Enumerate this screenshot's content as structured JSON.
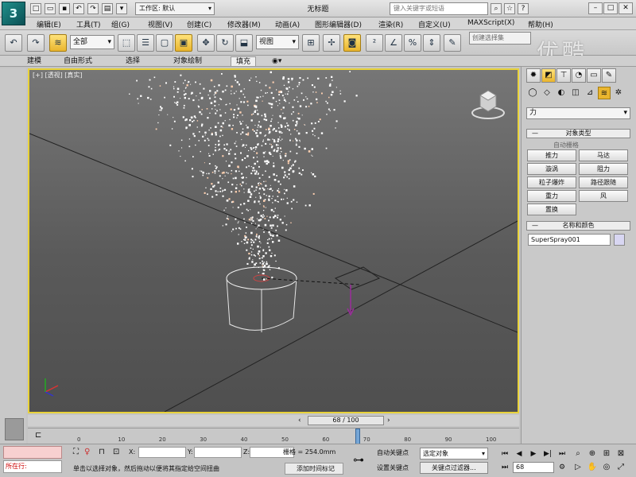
{
  "title_bar": {
    "app_logo": "3",
    "workspace": "工作区: 默认",
    "doc_title": "无标题",
    "help_search_placeholder": "键入关键字或短语"
  },
  "menu": [
    "编辑(E)",
    "工具(T)",
    "组(G)",
    "视图(V)",
    "创建(C)",
    "修改器(M)",
    "动画(A)",
    "图形编辑器(D)",
    "渲染(R)",
    "自定义(U)",
    "MAXScript(X)",
    "帮助(H)"
  ],
  "toolbar": {
    "selection_filter": "全部",
    "ref_coord": "视图",
    "named_sel_placeholder": "创建选择集",
    "icons": [
      "undo-icon",
      "redo-icon",
      "link-icon",
      "unlink-icon",
      "bind-space-warp-icon",
      "select-object-icon",
      "select-by-name-icon",
      "rect-region-icon",
      "window-crossing-icon",
      "move-icon",
      "rotate-icon",
      "scale-icon",
      "pivot-icon",
      "snap-icon",
      "angle-snap-icon",
      "percent-snap-icon",
      "spinner-snap-icon",
      "mirror-icon",
      "align-icon"
    ]
  },
  "watermark": "优酷",
  "ribbon": {
    "tabs": [
      "建模",
      "自由形式",
      "选择",
      "对象绘制",
      "填充"
    ],
    "active": "填充"
  },
  "viewport": {
    "label": "[+] [透视] [真实]"
  },
  "command_panel": {
    "tabs": [
      "create-icon",
      "modify-icon",
      "hierarchy-icon",
      "motion-icon",
      "display-icon",
      "utilities-icon"
    ],
    "sub_tabs": [
      "geometry-icon",
      "shapes-icon",
      "lights-icon",
      "cameras-icon",
      "helpers-icon",
      "space-warps-icon",
      "systems-icon"
    ],
    "category": "力",
    "object_type_header": "对象类型",
    "autogrid": "自动栅格",
    "buttons": [
      "推力",
      "马达",
      "漩涡",
      "阻力",
      "粒子爆炸",
      "路径跟随",
      "重力",
      "风",
      "置换"
    ],
    "name_color_header": "名称和颜色",
    "object_name": "SuperSpray001"
  },
  "timeline": {
    "current_frame": 68,
    "total_frames": 100,
    "slider_label": "68 / 100",
    "ticks": [
      0,
      10,
      20,
      30,
      40,
      50,
      60,
      70,
      80,
      90,
      100
    ]
  },
  "status": {
    "selection_count": "所在行:",
    "coords": {
      "x_label": "X:",
      "y_label": "Y:",
      "z_label": "Z:"
    },
    "grid": "栅格 = 254.0mm",
    "prompt": "单击以选择对象，然后拖动以便将其指定给空间扭曲",
    "add_time_tag": "添加时间标记",
    "auto_key": "自动关键点",
    "set_key": "设置关键点",
    "key_filter_select": "选定对象",
    "key_filters": "关键点过滤器...",
    "frame_field": "68"
  },
  "colors": {
    "viewport_border": "#e8d23a",
    "active_icon": "#e9b52e",
    "panel_bg": "#c9c9c9",
    "time_marker": "#76a6d6"
  }
}
